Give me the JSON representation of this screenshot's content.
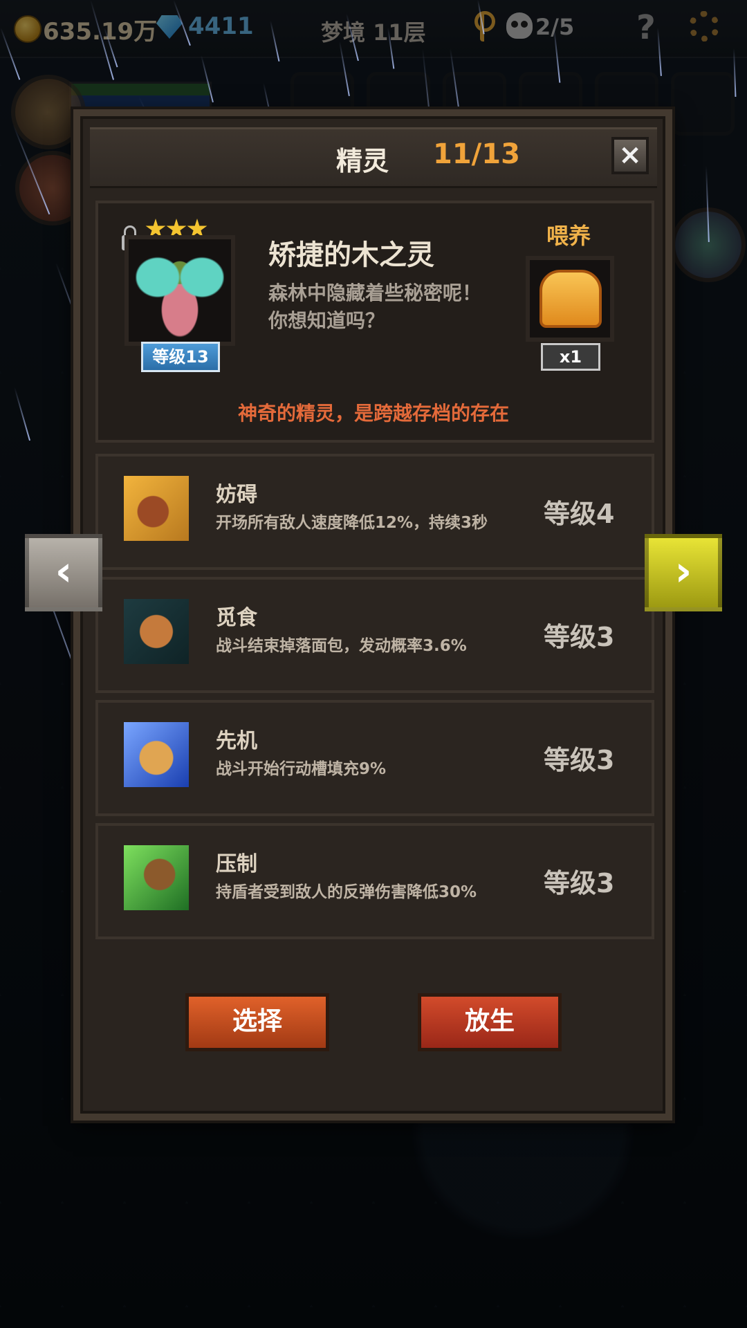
{
  "top_bar": {
    "gold": "635.19万",
    "gems": "4411",
    "floor": "梦境 11层",
    "skulls": "2/5",
    "help": "?"
  },
  "panel": {
    "title": "精灵",
    "count": "11/13",
    "close": "×"
  },
  "spirit": {
    "stars": 3,
    "name": "矫捷的木之灵",
    "desc_line1": "森林中隐藏着些秘密呢！",
    "desc_line2": "你想知道吗？",
    "level": "等级13",
    "notice": "神奇的精灵，是跨越存档的存在"
  },
  "feed": {
    "label": "喂养",
    "count": "x1",
    "item_icon": "bread-icon"
  },
  "skills": [
    {
      "name": "妨碍",
      "desc": "开场所有敌人速度降低12%，持续3秒",
      "level": "等级4",
      "icon": "chained-boot-icon"
    },
    {
      "name": "觅食",
      "desc": "战斗结束掉落面包，发动概率3.6%",
      "level": "等级3",
      "icon": "gingerbread-icon"
    },
    {
      "name": "先机",
      "desc": "战斗开始行动槽填充9%",
      "level": "等级3",
      "icon": "leopard-icon"
    },
    {
      "name": "压制",
      "desc": "持盾者受到敌人的反弹伤害降低30%",
      "level": "等级3",
      "icon": "beast-claw-icon"
    }
  ],
  "nav": {
    "prev": "‹",
    "next": "›"
  },
  "buttons": {
    "select": "选择",
    "release": "放生"
  },
  "colors": {
    "accent_orange": "#f0a33a",
    "notice_red": "#e46a3a",
    "level_blue": "#3d8bc9",
    "next_arrow_yellow": "#d8d52a"
  }
}
